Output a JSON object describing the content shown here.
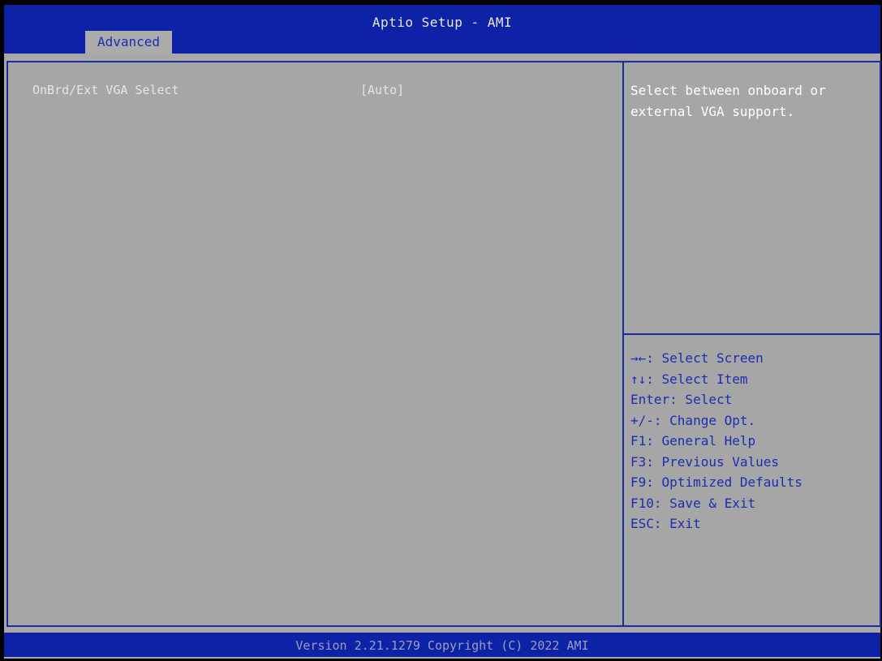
{
  "header": {
    "title": "Aptio Setup - AMI",
    "tabs": [
      {
        "label": "Advanced",
        "selected": true
      }
    ]
  },
  "main": {
    "settings": [
      {
        "label": "OnBrd/Ext VGA Select",
        "value": "[Auto]"
      }
    ]
  },
  "help": {
    "description": "Select between onboard or external VGA support.",
    "keys": [
      "→←: Select Screen",
      "↑↓: Select Item",
      "Enter: Select",
      "+/-: Change Opt.",
      "F1: General Help",
      "F3: Previous Values",
      "F9: Optimized Defaults",
      "F10: Save & Exit",
      "ESC: Exit"
    ]
  },
  "footer": {
    "version": "Version 2.21.1279 Copyright (C) 2022 AMI"
  },
  "colors": {
    "header_bg": "#0e22a8",
    "panel_bg": "#a6a6a6",
    "border": "#1a2aa0",
    "key_text": "#1a2eb0",
    "text_white": "#ffffff"
  }
}
